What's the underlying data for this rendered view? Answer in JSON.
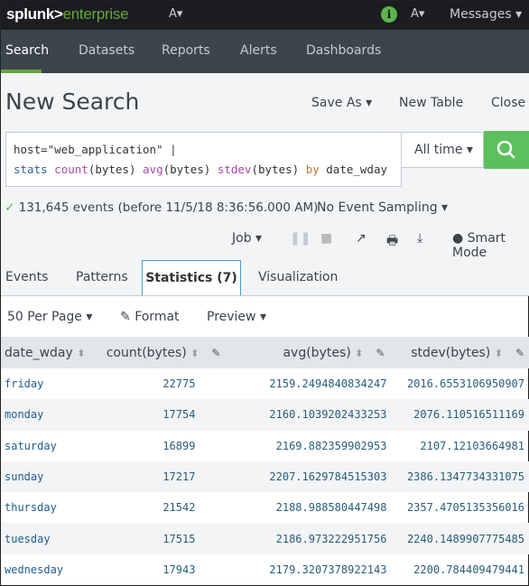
{
  "topbar": {
    "logo_a": "splunk>",
    "logo_b": "enterprise",
    "info_icon": "i",
    "messages": "Messages ▾"
  },
  "nav": {
    "items": [
      "Search",
      "Datasets",
      "Reports",
      "Alerts",
      "Dashboards"
    ],
    "active": "Search"
  },
  "header": {
    "title": "New Search",
    "save_as": "Save As ▾",
    "new_table": "New Table",
    "close": "Close"
  },
  "search": {
    "line1": "host=\"web_application\" |",
    "q_stats": "stats",
    "q_count": "count",
    "q_b1": "(bytes) ",
    "q_avg": "avg",
    "q_b2": "(bytes) ",
    "q_stdev": "stdev",
    "q_b3": "(bytes) ",
    "q_by": "by",
    "q_field": " date_wday",
    "time_range": "All time ▾"
  },
  "status": {
    "check": "✓",
    "events": "131,645 events (before 11/5/18 8:36:56.000 AM)",
    "sampling": "No Event Sampling ▾"
  },
  "job": {
    "job": "Job ▾",
    "smart_mode": "Smart Mode"
  },
  "tabs": [
    "Events",
    "Patterns",
    "Statistics (7)",
    "Visualization"
  ],
  "controls": {
    "per_page": "50 Per Page ▾",
    "format": "Format",
    "preview": "Preview ▾"
  },
  "table": {
    "columns": [
      "date_wday",
      "count(bytes)",
      "avg(bytes)",
      "stdev(bytes)"
    ],
    "rows": [
      [
        "friday",
        "22775",
        "2159.2494840834247",
        "2016.6553106950907"
      ],
      [
        "monday",
        "17754",
        "2160.1039202433253",
        "2076.110516511169"
      ],
      [
        "saturday",
        "16899",
        "2169.882359902953",
        "2107.12103664981"
      ],
      [
        "sunday",
        "17217",
        "2207.1629784515303",
        "2386.1347734331075"
      ],
      [
        "thursday",
        "21542",
        "2188.988580447498",
        "2357.4705135356016"
      ],
      [
        "tuesday",
        "17515",
        "2186.973222951756",
        "2240.1489907775485"
      ],
      [
        "wednesday",
        "17943",
        "2179.3207378922143",
        "2200.784409479441"
      ]
    ]
  },
  "colors": {
    "brand_green": "#65a637",
    "search_button": "#5cc05c",
    "active_tab_border": "#4a9bd4"
  }
}
